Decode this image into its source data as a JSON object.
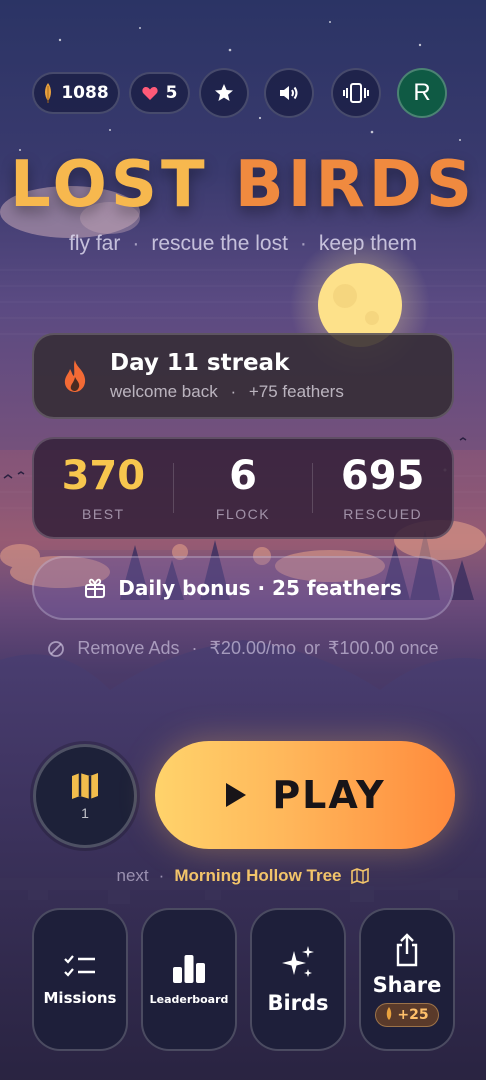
{
  "game": {
    "title_word1": "LOST",
    "title_word2": "BIRDS",
    "tagline": [
      "fly far",
      "rescue the lost",
      "keep them"
    ],
    "tagline_sep": "·"
  },
  "topbar": {
    "feathers": "1088",
    "hearts": "5",
    "avatar_initial": "R",
    "icons": [
      "feather-icon",
      "heart-icon",
      "star-icon",
      "speaker-icon",
      "vibrate-icon"
    ]
  },
  "streak": {
    "title": "Day 11 streak",
    "subtitle_left": "welcome back",
    "subtitle_sep": "·",
    "subtitle_right": "+75 feathers"
  },
  "stats": [
    {
      "value": "370",
      "label": "BEST",
      "color": "#f7c64e"
    },
    {
      "value": "6",
      "label": "FLOCK",
      "color": "#ffffff"
    },
    {
      "value": "695",
      "label": "RESCUED",
      "color": "#ffffff"
    }
  ],
  "bonus": {
    "label": "Daily bonus · 25 feathers"
  },
  "ads": {
    "label": "Remove Ads",
    "sep": "·",
    "monthly": "₹20.00/mo",
    "or": "or",
    "once": "₹100.00 once"
  },
  "map": {
    "count": "1"
  },
  "play": {
    "label": "PLAY"
  },
  "next": {
    "label": "next",
    "sep": "·",
    "destination": "Morning Hollow Tree"
  },
  "bottom": {
    "missions": "Missions",
    "leaderboard": "Leaderboard",
    "birds": "Birds",
    "share": "Share",
    "share_badge": "+25"
  },
  "colors": {
    "accent_gold": "#f7b84e",
    "accent_orange": "#f08a3f",
    "avatar_bg": "#0f5a44",
    "heart": "#ff5a78"
  }
}
